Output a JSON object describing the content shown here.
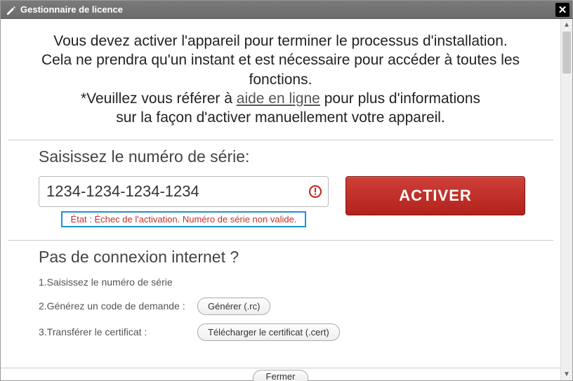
{
  "window": {
    "title": "Gestionnaire de licence",
    "close_icon": "✕"
  },
  "intro": {
    "line1": "Vous devez activer l'appareil pour terminer le processus d'installation.",
    "line2": "Cela ne prendra qu'un instant et est nécessaire pour accéder à toutes les fonctions.",
    "line3_prefix": "*Veuillez vous référer à ",
    "line3_link": "aide en ligne",
    "line3_suffix": " pour plus d'informations",
    "line4": "sur la façon d'activer manuellement votre appareil."
  },
  "serial": {
    "title": "Saisissez le numéro de série:",
    "value": "1234-1234-1234-1234",
    "activate_label": "ACTIVER",
    "status": "État : Échec de l'activation. Numéro de série non valide."
  },
  "offline": {
    "title": "Pas de connexion internet ?",
    "step1": "1.Saisissez le numéro de série",
    "step2": "2.Générez un code de demande :",
    "step2_btn": "Générer (.rc)",
    "step3": "3.Transférer le certificat :",
    "step3_btn": "Télécharger le certificat (.cert)"
  },
  "footer": {
    "close_label": "Fermer"
  }
}
